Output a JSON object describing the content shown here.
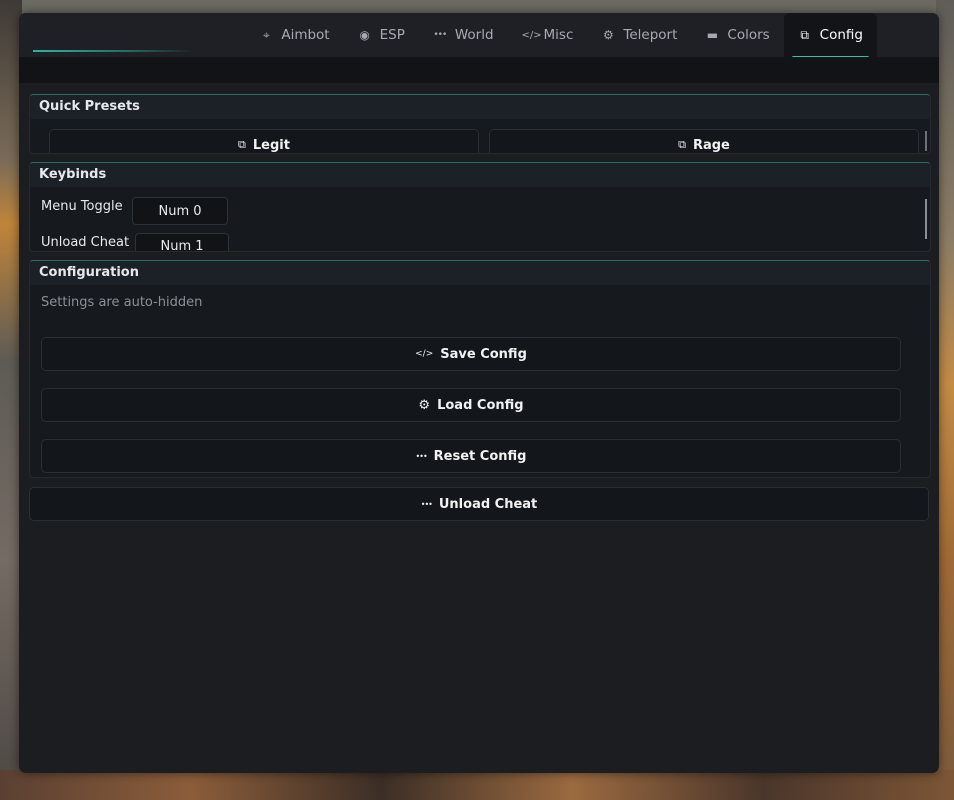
{
  "tabs": [
    {
      "label": "Aimbot",
      "icon": "crosshair-icon",
      "glyph": "⌖"
    },
    {
      "label": "ESP",
      "icon": "eye-icon",
      "glyph": "◉"
    },
    {
      "label": "World",
      "icon": "dots-icon",
      "glyph": "•••"
    },
    {
      "label": "Misc",
      "icon": "code-icon",
      "glyph": "</>"
    },
    {
      "label": "Teleport",
      "icon": "gear-icon",
      "glyph": "⚙"
    },
    {
      "label": "Colors",
      "icon": "window-icon",
      "glyph": "▬"
    },
    {
      "label": "Config",
      "icon": "copy-icon",
      "glyph": "⧉",
      "active": true
    }
  ],
  "quick_presets": {
    "title": "Quick Presets",
    "legit": {
      "label": "Legit",
      "glyph": "⧉"
    },
    "rage": {
      "label": "Rage",
      "glyph": "⧉"
    }
  },
  "keybinds": {
    "title": "Keybinds",
    "rows": [
      {
        "label": "Menu Toggle",
        "key": "Num 0"
      },
      {
        "label": "Unload Cheat",
        "key": "Num 1"
      }
    ]
  },
  "configuration": {
    "title": "Configuration",
    "hint": "Settings are auto-hidden",
    "save": {
      "label": "Save Config",
      "glyph": "</>"
    },
    "load": {
      "label": "Load Config",
      "glyph": "⚙"
    },
    "reset": {
      "label": "Reset Config",
      "glyph": "•••"
    }
  },
  "unload": {
    "label": "Unload Cheat",
    "glyph": "•••"
  },
  "colors": {
    "accent": "#2fc3ad",
    "panel": "#1b1d21"
  }
}
